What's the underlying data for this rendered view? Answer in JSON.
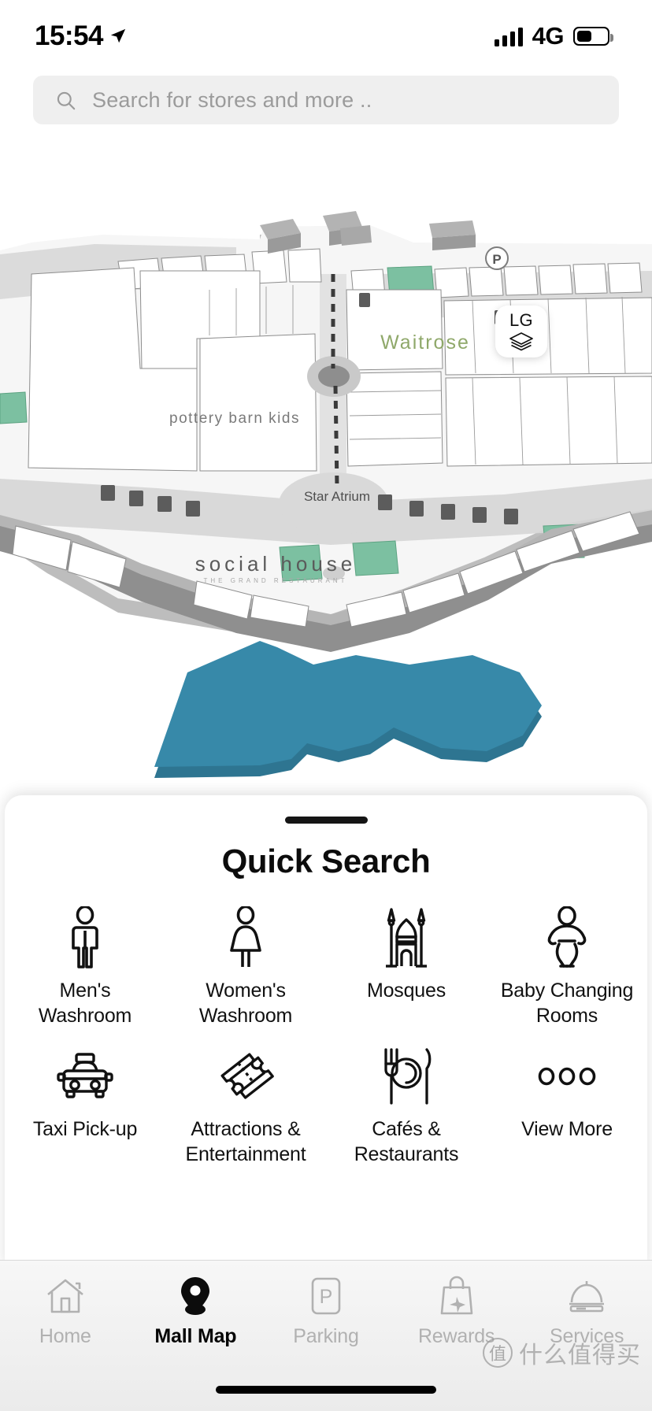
{
  "status_bar": {
    "time": "15:54",
    "location_icon": "location-arrow-icon",
    "signal_icon": "signal-bars-icon",
    "network": "4G",
    "battery_icon": "battery-icon"
  },
  "search": {
    "placeholder": "Search for stores and more ..",
    "value": "",
    "icon": "search-icon"
  },
  "map": {
    "floor_selector": {
      "label": "LG",
      "icon": "layers-icon"
    },
    "parking_marker": "P",
    "labels": [
      {
        "text": "Waitrose",
        "color": "#8fa86a"
      },
      {
        "text": "pottery barn kids",
        "color": "#6b6b6b"
      },
      {
        "text": "Star Atrium",
        "color": "#4a4a4a"
      },
      {
        "text": "social house",
        "color": "#4a4a4a"
      },
      {
        "text": "THE GRAND RESTAURANT",
        "color": "#9a9a9a"
      }
    ],
    "colors": {
      "water": "#3789a9",
      "water_edge": "#2e7591",
      "floor": "#ffffff",
      "walkway": "#d4d4d4",
      "wall": "#9a9a9a",
      "highlight_store": "#7cbfa1"
    }
  },
  "quick_search": {
    "title": "Quick Search",
    "items": [
      {
        "label": "Men's\nWashroom",
        "icon": "mens-washroom-icon"
      },
      {
        "label": "Women's\nWashroom",
        "icon": "womens-washroom-icon"
      },
      {
        "label": "Mosques",
        "icon": "mosque-icon"
      },
      {
        "label": "Baby Changing\nRooms",
        "icon": "baby-changing-icon"
      },
      {
        "label": "Taxi Pick-up",
        "icon": "taxi-icon"
      },
      {
        "label": "Attractions &\nEntertainment",
        "icon": "tickets-icon"
      },
      {
        "label": "Cafés &\nRestaurants",
        "icon": "cutlery-icon"
      },
      {
        "label": "View More",
        "icon": "three-dots-icon"
      }
    ]
  },
  "tab_bar": {
    "items": [
      {
        "label": "Home",
        "icon": "home-icon",
        "active": false
      },
      {
        "label": "Mall Map",
        "icon": "map-pin-icon",
        "active": true
      },
      {
        "label": "Parking",
        "icon": "parking-icon",
        "active": false
      },
      {
        "label": "Rewards",
        "icon": "rewards-bag-icon",
        "active": false
      },
      {
        "label": "Services",
        "icon": "service-bell-icon",
        "active": false
      }
    ]
  },
  "watermark": {
    "badge": "值",
    "text": "什么值得买"
  }
}
